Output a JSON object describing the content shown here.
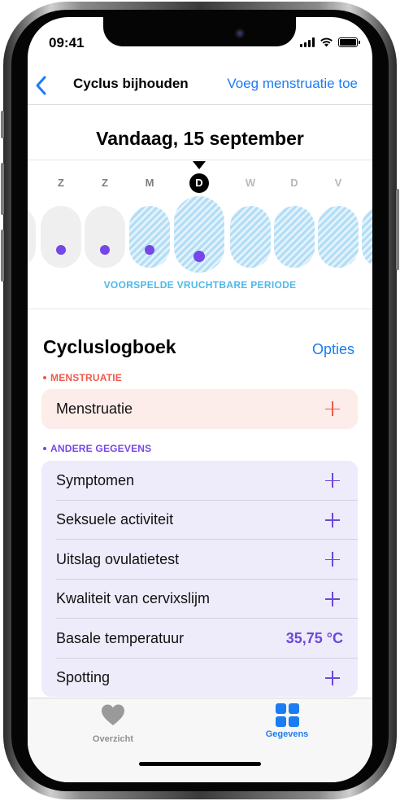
{
  "status_bar": {
    "time": "09:41"
  },
  "nav": {
    "title": "Cyclus bijhouden",
    "action": "Voeg menstruatie toe"
  },
  "date_title": "Vandaag, 15 september",
  "calendar": {
    "days": [
      {
        "letter": "Z",
        "fertile": false,
        "logged": true,
        "today": false,
        "future": false
      },
      {
        "letter": "Z",
        "fertile": false,
        "logged": true,
        "today": false,
        "future": false
      },
      {
        "letter": "M",
        "fertile": true,
        "logged": true,
        "today": false,
        "future": false
      },
      {
        "letter": "D",
        "fertile": true,
        "logged": true,
        "today": true,
        "future": false
      },
      {
        "letter": "W",
        "fertile": true,
        "logged": false,
        "today": false,
        "future": true
      },
      {
        "letter": "D",
        "fertile": true,
        "logged": false,
        "today": false,
        "future": true
      },
      {
        "letter": "V",
        "fertile": true,
        "logged": false,
        "today": false,
        "future": true
      }
    ],
    "fertile_label": "VOORSPELDE VRUCHTBARE PERIODE"
  },
  "log": {
    "title": "Cycluslogboek",
    "options": "Opties",
    "menstruation_section": {
      "label": "MENSTRUATIE",
      "rows": [
        {
          "label": "Menstruatie"
        }
      ]
    },
    "other_section": {
      "label": "ANDERE GEGEVENS",
      "rows": [
        {
          "label": "Symptomen",
          "value": ""
        },
        {
          "label": "Seksuele activiteit",
          "value": ""
        },
        {
          "label": "Uitslag ovulatietest",
          "value": ""
        },
        {
          "label": "Kwaliteit van cervixslijm",
          "value": ""
        },
        {
          "label": "Basale temperatuur",
          "value": "35,75 °C"
        },
        {
          "label": "Spotting",
          "value": ""
        }
      ]
    }
  },
  "tabbar": {
    "tabs": [
      {
        "label": "Overzicht",
        "icon": "heart-icon",
        "active": false
      },
      {
        "label": "Gegevens",
        "icon": "grid-icon",
        "active": true
      }
    ]
  },
  "colors": {
    "accent": "#1b7cf3",
    "menstruation": "#ef5a4c",
    "other_data": "#7547e8",
    "fertile": "#4fb8e8"
  }
}
